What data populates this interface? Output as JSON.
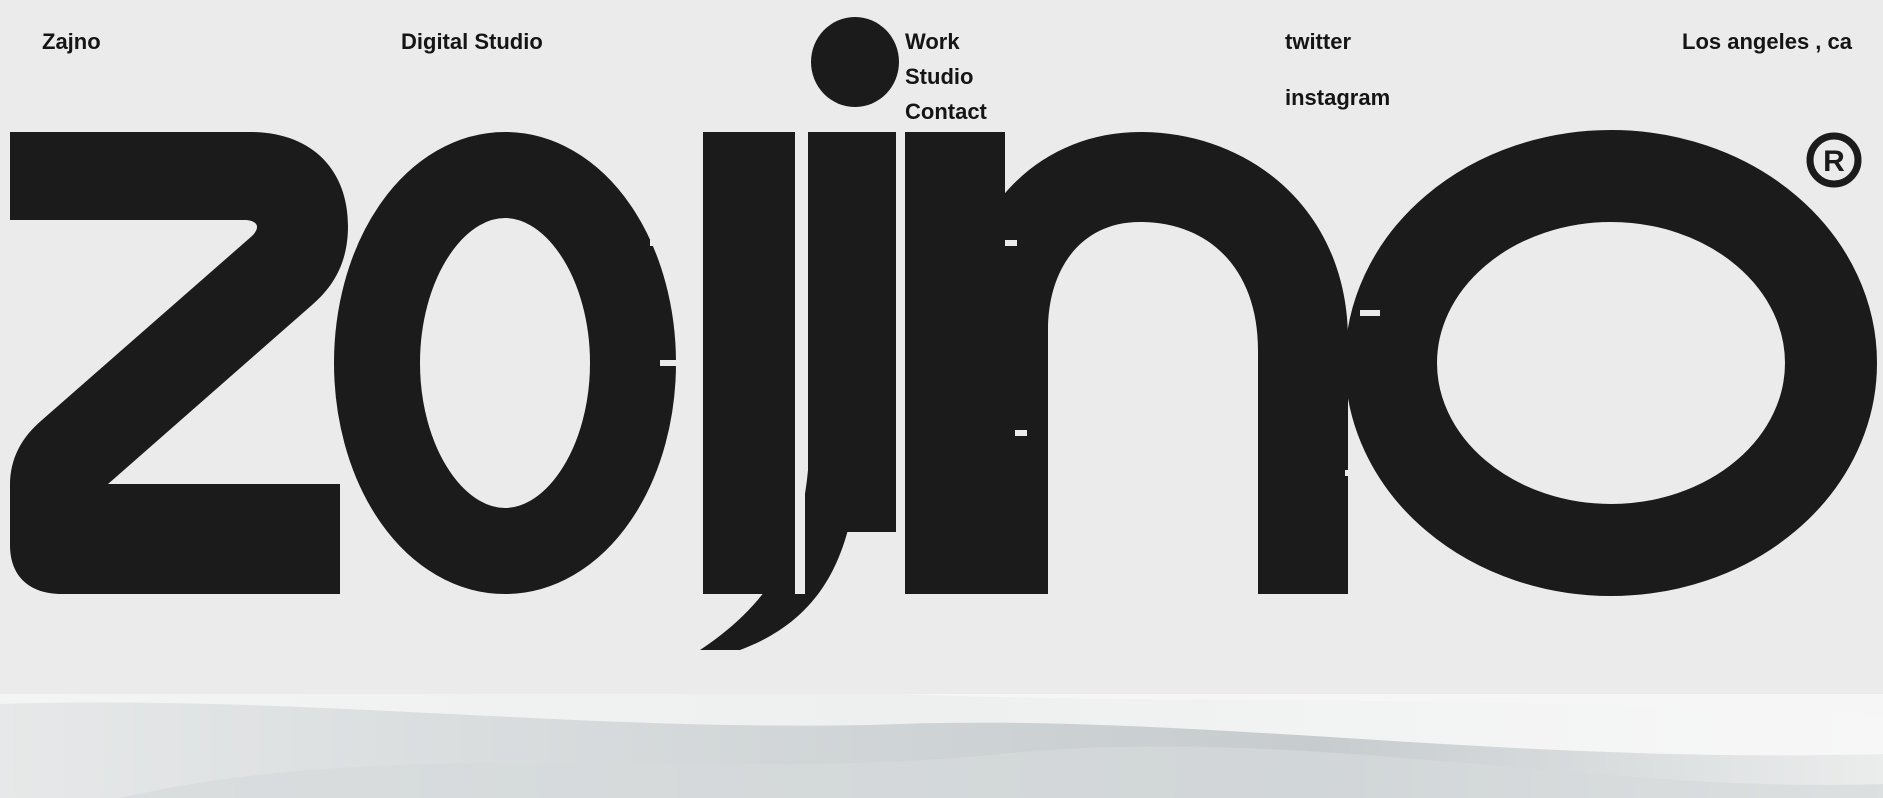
{
  "header": {
    "brand": "Zajno",
    "tagline": "Digital Studio",
    "menu": [
      {
        "label": "Work"
      },
      {
        "label": "Studio"
      },
      {
        "label": "Contact"
      }
    ],
    "social": {
      "twitter": "twitter",
      "instagram": "instagram"
    },
    "location": "Los angeles , ca"
  },
  "logo": {
    "wordmark": "zajno",
    "registered_mark": "®"
  },
  "colors": {
    "background": "#ebebeb",
    "ink": "#1b1b1b"
  }
}
